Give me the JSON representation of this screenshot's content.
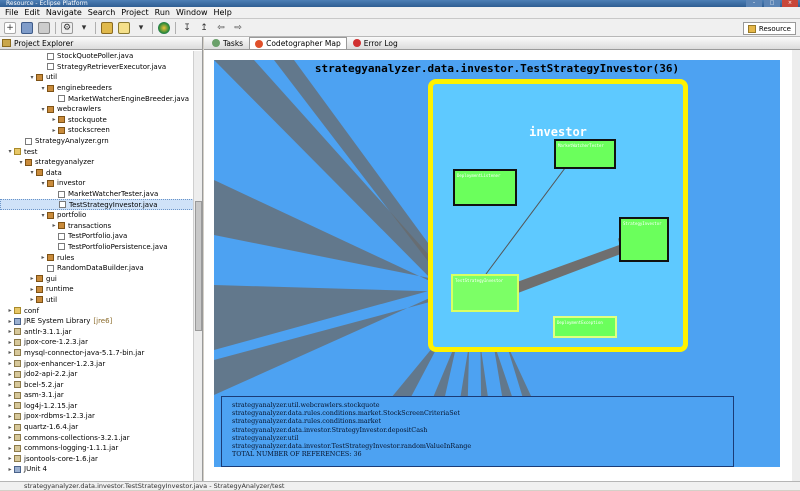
{
  "window": {
    "title": "Resource - Eclipse Platform"
  },
  "menu": [
    "File",
    "Edit",
    "Navigate",
    "Search",
    "Project",
    "Run",
    "Window",
    "Help"
  ],
  "perspective": {
    "label": "Resource"
  },
  "explorer": {
    "tab_label": "Project Explorer",
    "rows": [
      {
        "indent": 3,
        "twisty": "",
        "icon": "java",
        "label": "StockQuotePoller.java"
      },
      {
        "indent": 3,
        "twisty": "",
        "icon": "java",
        "label": "StrategyRetrieverExecutor.java"
      },
      {
        "indent": 2,
        "twisty": "▾",
        "icon": "pkg",
        "label": "util"
      },
      {
        "indent": 3,
        "twisty": "▾",
        "icon": "pkg",
        "label": "enginebreeders"
      },
      {
        "indent": 4,
        "twisty": "",
        "icon": "java",
        "label": "MarketWatcherEngineBreeder.java"
      },
      {
        "indent": 3,
        "twisty": "▾",
        "icon": "pkg",
        "label": "webcrawlers"
      },
      {
        "indent": 4,
        "twisty": "▸",
        "icon": "pkg",
        "label": "stockquote"
      },
      {
        "indent": 4,
        "twisty": "▸",
        "icon": "pkg",
        "label": "stockscreen"
      },
      {
        "indent": 1,
        "twisty": "",
        "icon": "file",
        "label": "StrategyAnalyzer.grn"
      },
      {
        "indent": 0,
        "twisty": "▾",
        "icon": "folder",
        "label": "test"
      },
      {
        "indent": 1,
        "twisty": "▾",
        "icon": "pkg",
        "label": "strategyanalyzer"
      },
      {
        "indent": 2,
        "twisty": "▾",
        "icon": "pkg",
        "label": "data"
      },
      {
        "indent": 3,
        "twisty": "▾",
        "icon": "pkg",
        "label": "investor"
      },
      {
        "indent": 4,
        "twisty": "",
        "icon": "java",
        "label": "MarketWatcherTester.java"
      },
      {
        "indent": 4,
        "twisty": "",
        "icon": "java",
        "label": "TestStrategyInvestor.java",
        "selected": true
      },
      {
        "indent": 3,
        "twisty": "▾",
        "icon": "pkg",
        "label": "portfolio"
      },
      {
        "indent": 4,
        "twisty": "▸",
        "icon": "pkg",
        "label": "transactions"
      },
      {
        "indent": 4,
        "twisty": "",
        "icon": "java",
        "label": "TestPortfolio.java"
      },
      {
        "indent": 4,
        "twisty": "",
        "icon": "java",
        "label": "TestPortfolioPersistence.java"
      },
      {
        "indent": 3,
        "twisty": "▸",
        "icon": "pkg",
        "label": "rules"
      },
      {
        "indent": 3,
        "twisty": "",
        "icon": "java",
        "label": "RandomDataBuilder.java"
      },
      {
        "indent": 2,
        "twisty": "▸",
        "icon": "pkg",
        "label": "gui"
      },
      {
        "indent": 2,
        "twisty": "▸",
        "icon": "pkg",
        "label": "runtime"
      },
      {
        "indent": 2,
        "twisty": "▸",
        "icon": "pkg",
        "label": "util"
      },
      {
        "indent": 0,
        "twisty": "▸",
        "icon": "folder",
        "label": "conf"
      },
      {
        "indent": 0,
        "twisty": "▸",
        "icon": "lib",
        "label": "JRE System Library",
        "decoration": "[jre6]"
      },
      {
        "indent": 0,
        "twisty": "▸",
        "icon": "jar",
        "label": "antlr-3.1.1.jar"
      },
      {
        "indent": 0,
        "twisty": "▸",
        "icon": "jar",
        "label": "jpox-core-1.2.3.jar"
      },
      {
        "indent": 0,
        "twisty": "▸",
        "icon": "jar",
        "label": "mysql-connector-java-5.1.7-bin.jar"
      },
      {
        "indent": 0,
        "twisty": "▸",
        "icon": "jar",
        "label": "jpox-enhancer-1.2.3.jar"
      },
      {
        "indent": 0,
        "twisty": "▸",
        "icon": "jar",
        "label": "jdo2-api-2.2.jar"
      },
      {
        "indent": 0,
        "twisty": "▸",
        "icon": "jar",
        "label": "bcel-5.2.jar"
      },
      {
        "indent": 0,
        "twisty": "▸",
        "icon": "jar",
        "label": "asm-3.1.jar"
      },
      {
        "indent": 0,
        "twisty": "▸",
        "icon": "jar",
        "label": "log4j-1.2.15.jar"
      },
      {
        "indent": 0,
        "twisty": "▸",
        "icon": "jar",
        "label": "jpox-rdbms-1.2.3.jar"
      },
      {
        "indent": 0,
        "twisty": "▸",
        "icon": "jar",
        "label": "quartz-1.6.4.jar"
      },
      {
        "indent": 0,
        "twisty": "▸",
        "icon": "jar",
        "label": "commons-collections-3.2.1.jar"
      },
      {
        "indent": 0,
        "twisty": "▸",
        "icon": "jar",
        "label": "commons-logging-1.1.1.jar"
      },
      {
        "indent": 0,
        "twisty": "▸",
        "icon": "jar",
        "label": "jsontools-core-1.6.jar"
      },
      {
        "indent": 0,
        "twisty": "▸",
        "icon": "lib",
        "label": "JUnit 4"
      }
    ]
  },
  "editor": {
    "tabs": [
      {
        "label": "Tasks",
        "icon_color": "#6aa06a"
      },
      {
        "label": "Codetographer Map",
        "icon_color": "#e0502a",
        "active": true
      },
      {
        "label": "Error Log",
        "icon_color": "#d03030"
      }
    ],
    "map": {
      "title": "strategyanalyzer.data.investor.TestStrategyInvestor(36)",
      "package_label": "investor",
      "classes": [
        {
          "name": "MarketWatcherTester"
        },
        {
          "name": "DeploymentListener"
        },
        {
          "name": "StrategyInvestor"
        },
        {
          "name": "TestStrategyInvestor"
        },
        {
          "name": "DeploymentException"
        }
      ],
      "references": [
        "strategyanalyzer.util.webcrawlers.stockquote",
        "strategyanalyzer.data.rules.conditions.market.StockScreenCriteriaSet",
        "strategyanalyzer.data.rules.conditions.market",
        "strategyanalyzer.data.investor.StrategyInvestor.depositCash",
        "strategyanalyzer.util",
        "strategyanalyzer.data.investor.TestStrategyInvestor.randomValueInRange",
        "TOTAL NUMBER OF REFERENCES: 36"
      ]
    }
  },
  "status": {
    "text": "strategyanalyzer.data.investor.TestStrategyInvestor.java - StrategyAnalyzer/test"
  }
}
